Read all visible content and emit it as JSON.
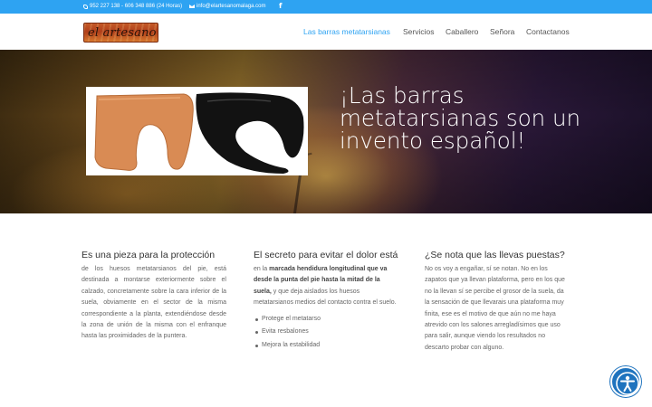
{
  "topbar": {
    "phone": "952 227 138 - 606 348 886 (24 Horas)",
    "email": "info@elartesanomalaga.com",
    "facebook_icon": "f"
  },
  "header": {
    "logo_text": "el artesano",
    "nav": [
      {
        "label": "Las barras metatarsianas",
        "active": true
      },
      {
        "label": "Servicios",
        "active": false
      },
      {
        "label": "Caballero",
        "active": false
      },
      {
        "label": "Señora",
        "active": false
      },
      {
        "label": "Contactanos",
        "active": false
      }
    ]
  },
  "hero": {
    "title": "¡Las barras metatarsianas son un invento español!"
  },
  "columns": {
    "col1": {
      "heading": "Es una pieza para la protección",
      "body": "de los huesos metatarsianos del pie, está destinada a montarse exteriormente sobre el calzado, concretamente sobre la cara inferior de la suela, obviamente en el sector de la misma correspondiente a la planta, extendiéndose desde la zona de unión de la misma con el enfranque hasta las proximidades de la puntera."
    },
    "col2": {
      "heading": "El secreto para evitar el dolor está",
      "body_pre": "en la ",
      "body_strong": "marcada hendidura longitudinal que va desde la punta del pie hasta la mitad de la suela,",
      "body_post": " y que deja aislados los huesos metatarsianos medios del contacto contra el suelo.",
      "bullets": [
        "Protege el metatarso",
        "Evita resbalones",
        "Mejora la estabilidad"
      ]
    },
    "col3": {
      "heading": "¿Se nota que las llevas puestas?",
      "body": "No os voy a engañar, sí se notan. No en los zapatos que ya llevan plataforma, pero en los que no la llevan sí se percibe el grosor de la suela, da la sensación de que llevarais una plataforma muy finita, ese es el motivo de que aún no me haya atrevido con los salones arregladísimos que uso para salir, aunque viendo los resultados no descarto probar con alguno."
    }
  },
  "icons": {
    "phone": "phone-icon",
    "mail": "mail-icon",
    "facebook": "facebook-icon",
    "accessibility": "accessibility-icon"
  },
  "colors": {
    "accent": "#2ea3f2",
    "accessibility_button": "#1e73be"
  }
}
